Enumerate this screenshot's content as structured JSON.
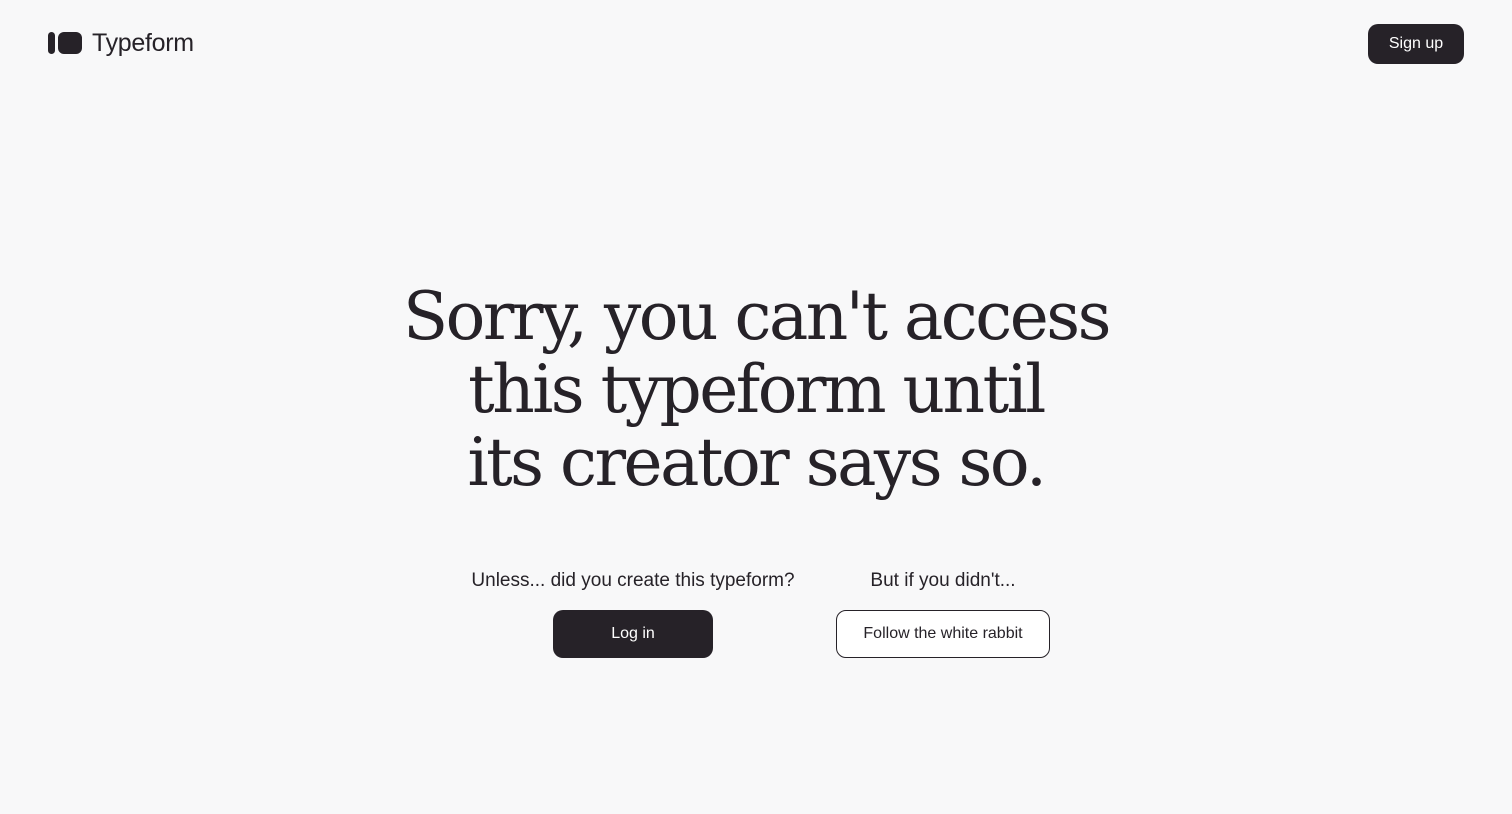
{
  "header": {
    "brand_name": "Typeform",
    "logo_icon": "typeform-logo-icon",
    "signup_label": "Sign up"
  },
  "main": {
    "headline_lines": [
      "Sorry, you can't access",
      "this typeform until",
      "its creator says so."
    ],
    "creator_prompt": "Unless... did you create this typeform?",
    "login_label": "Log in",
    "other_prompt": "But if you didn't...",
    "rabbit_label": "Follow the white rabbit"
  },
  "colors": {
    "background": "#f8f8f9",
    "primary": "#262228",
    "button_text": "#ffffff"
  }
}
